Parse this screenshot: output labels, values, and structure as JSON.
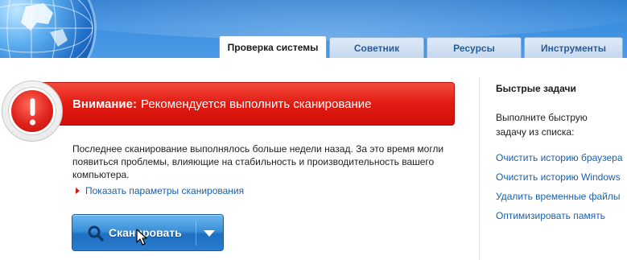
{
  "tabs": [
    {
      "label": "Проверка системы",
      "active": true
    },
    {
      "label": "Советник",
      "active": false
    },
    {
      "label": "Ресурсы",
      "active": false
    },
    {
      "label": "Инструменты",
      "active": false
    }
  ],
  "alert": {
    "strong": "Внимание:",
    "text": "Рекомендуется выполнить сканирование",
    "icon": "exclamation-icon",
    "color": "#e21b12"
  },
  "main": {
    "description": "Последнее сканирование выполнялось больше недели назад. За это время могли появиться проблемы, влияющие на стабильность и производительность вашего компьютера.",
    "params_link": "Показать параметры сканирования",
    "scan_button": "Сканировать"
  },
  "sidebar": {
    "title": "Быстрые задачи",
    "description": "Выполните быструю задачу из списка:",
    "links": [
      "Очистить историю браузера",
      "Очистить историю Windows",
      "Удалить временные файлы",
      "Оптимизировать память"
    ]
  },
  "colors": {
    "header": "#3d8fe0",
    "link": "#1b5fa8",
    "button": "#2a7ccd"
  }
}
